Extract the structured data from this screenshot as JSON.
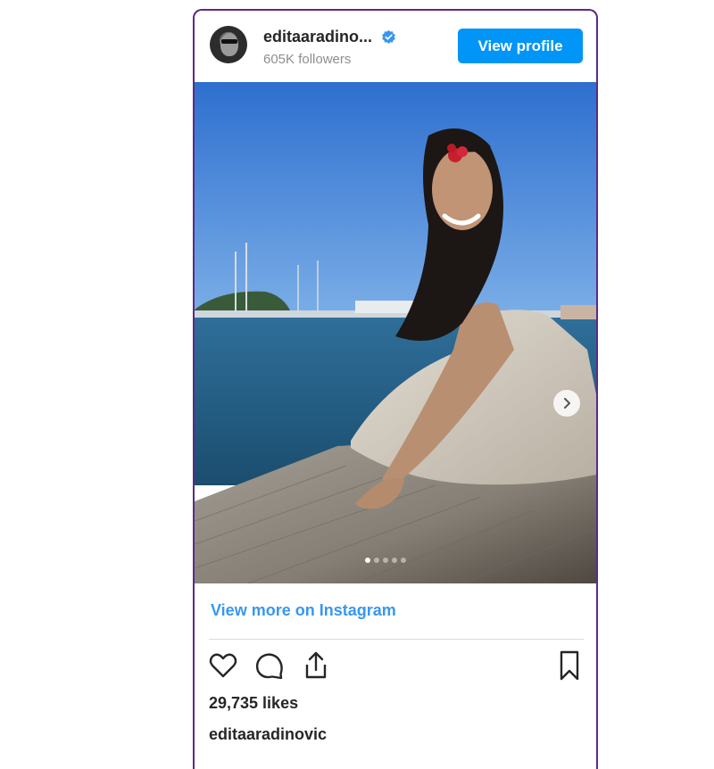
{
  "post": {
    "username": "editaaradino...",
    "followers": "605K followers",
    "view_profile_label": "View profile",
    "view_more_label": "View more on Instagram",
    "likes": "29,735 likes",
    "caption_username": "editaaradinovic",
    "carousel": {
      "slide_count": 5,
      "active_index": 0
    }
  },
  "icons": {
    "verified": "verified-badge-icon",
    "next": "chevron-right-icon",
    "like": "heart-icon",
    "comment": "comment-icon",
    "share": "share-icon",
    "save": "bookmark-icon"
  },
  "colors": {
    "accent": "#0095f6",
    "link": "#3897f0",
    "frame": "#5a2a86"
  }
}
